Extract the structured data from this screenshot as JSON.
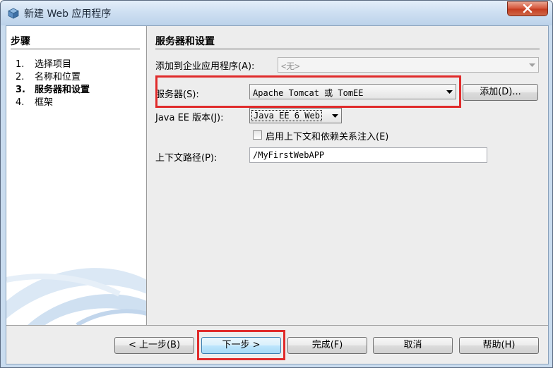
{
  "window": {
    "title": "新建 Web 应用程序",
    "close_label": "×"
  },
  "steps": {
    "title": "步骤",
    "items": [
      {
        "num": "1.",
        "label": "选择项目",
        "active": false
      },
      {
        "num": "2.",
        "label": "名称和位置",
        "active": false
      },
      {
        "num": "3.",
        "label": "服务器和设置",
        "active": true
      },
      {
        "num": "4.",
        "label": "框架",
        "active": false
      }
    ]
  },
  "main": {
    "section_title": "服务器和设置",
    "enterprise": {
      "label": "添加到企业应用程序(A):",
      "value": "<无>"
    },
    "server": {
      "label": "服务器(S):",
      "value": "Apache Tomcat 或 TomEE",
      "add_button": "添加(D)..."
    },
    "javaee": {
      "label": "Java EE 版本(J):",
      "value": "Java EE 6 Web"
    },
    "cdi": {
      "label": "启用上下文和依赖关系注入(E)",
      "checked": false
    },
    "context_path": {
      "label": "上下文路径(P):",
      "value": "/MyFirstWebAPP"
    }
  },
  "footer": {
    "prev": "< 上一步(B)",
    "next": "下一步 >",
    "finish": "完成(F)",
    "cancel": "取消",
    "help": "帮助(H)"
  },
  "colors": {
    "highlight": "#e02b2b"
  }
}
